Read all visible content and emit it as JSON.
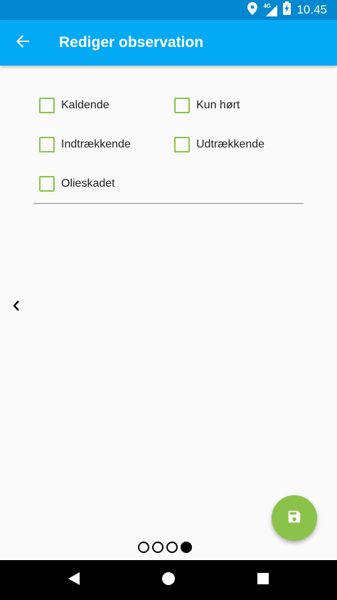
{
  "status_bar": {
    "network": "4G",
    "time": "10.45",
    "icons": [
      "location-icon",
      "signal-icon",
      "battery-charging-icon"
    ]
  },
  "app_bar": {
    "title": "Rediger observation",
    "back_icon": "arrow-left-icon"
  },
  "checkboxes": [
    {
      "label": "Kaldende",
      "checked": false
    },
    {
      "label": "Kun hørt",
      "checked": false
    },
    {
      "label": "Indtrækkende",
      "checked": false
    },
    {
      "label": "Udtrækkende",
      "checked": false
    },
    {
      "label": "Olieskadet",
      "checked": false
    }
  ],
  "pager": {
    "total_pages": 4,
    "current_page": 4
  },
  "fab": {
    "icon": "save-icon"
  },
  "colors": {
    "status_bar": "#0288d1",
    "app_bar": "#03a9f4",
    "accent": "#8bc34a",
    "background": "#fafafa"
  },
  "nav_bar": {
    "icons": [
      "back-triangle-icon",
      "home-circle-icon",
      "recents-square-icon"
    ]
  }
}
